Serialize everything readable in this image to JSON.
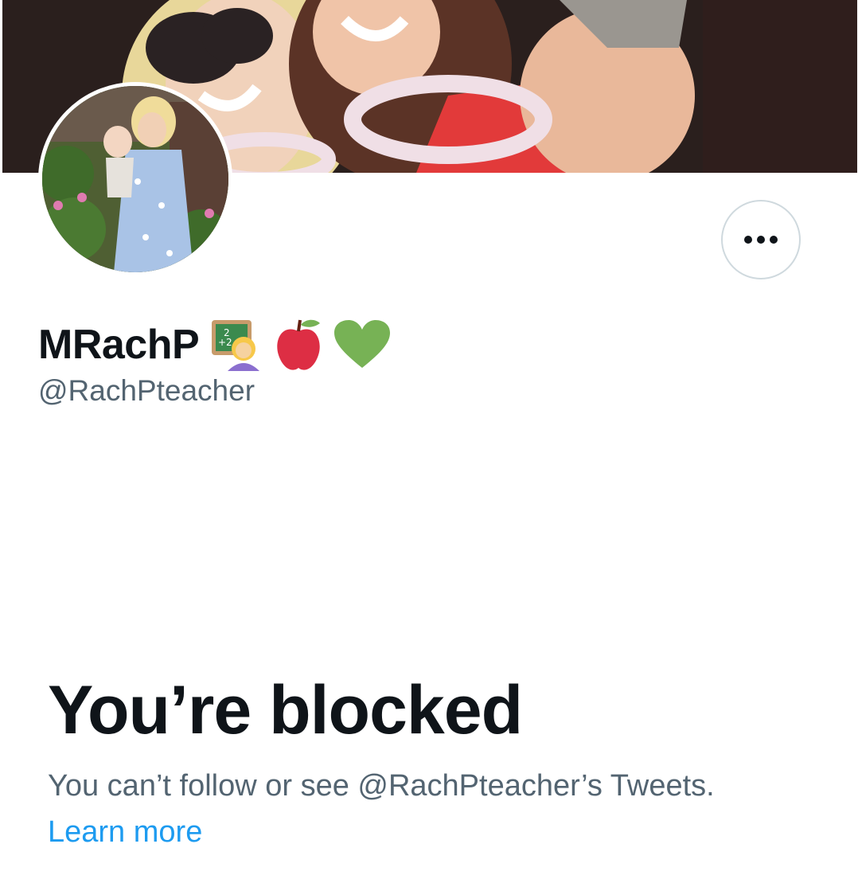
{
  "profile": {
    "display_name": "MRachP",
    "name_emojis": [
      "teacher-emoji",
      "apple-emoji",
      "green-heart-emoji"
    ],
    "handle": "@RachPteacher"
  },
  "blocked": {
    "title": "You’re blocked",
    "message": "You can’t follow or see @RachPteacher’s Tweets.",
    "learn_more": "Learn more"
  },
  "colors": {
    "primary_text": "#0f1419",
    "secondary_text": "#536471",
    "link": "#1d9bf0",
    "border": "#cfd9de"
  },
  "icons": {
    "more_button": "more-horizontal-icon"
  }
}
